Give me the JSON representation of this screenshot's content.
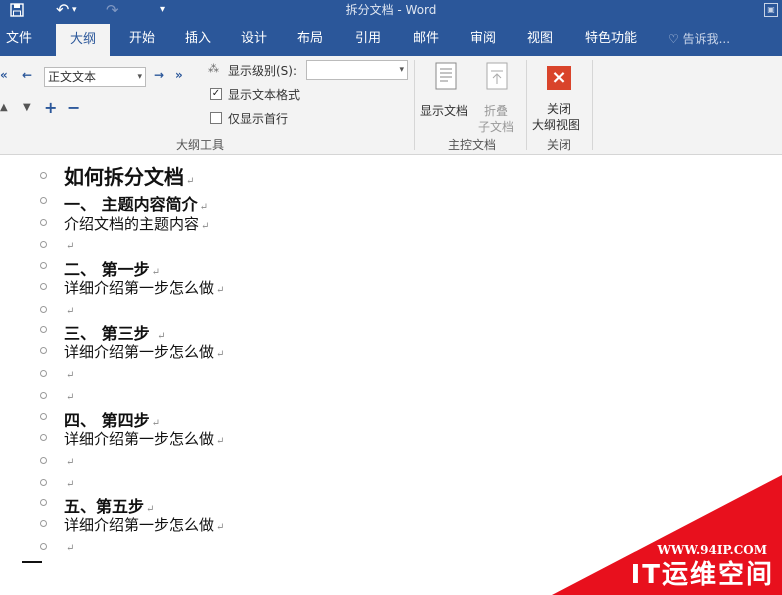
{
  "window": {
    "title": "拆分文档 - Word",
    "undo_glyph": "↶",
    "redo_glyph": "↷",
    "more_glyph": "▾"
  },
  "tabs": [
    {
      "label": "文件"
    },
    {
      "label": "大纲",
      "active": true
    },
    {
      "label": "开始"
    },
    {
      "label": "插入"
    },
    {
      "label": "设计"
    },
    {
      "label": "布局"
    },
    {
      "label": "引用"
    },
    {
      "label": "邮件"
    },
    {
      "label": "审阅"
    },
    {
      "label": "视图"
    },
    {
      "label": "特色功能"
    },
    {
      "label": "告诉我..."
    }
  ],
  "ribbon": {
    "outline_tools": {
      "group_label": "大纲工具",
      "level_value": "正文文本",
      "show_level_label": "显示级别(S):",
      "show_level_value": "",
      "show_text_format": "显示文本格式",
      "show_text_format_checked": true,
      "show_first_line": "仅显示首行",
      "show_first_line_checked": false
    },
    "master_doc": {
      "group_label": "主控文档",
      "show_doc": "显示文档",
      "collapse": "折叠",
      "subdoc": "子文档"
    },
    "close": {
      "group_label": "关闭",
      "label1": "关闭",
      "label2": "大纲视图"
    }
  },
  "document": {
    "lines": [
      {
        "text": "如何拆分文档",
        "mark": "↵"
      },
      {
        "text": "一、  主题内容简介",
        "mark": "↵"
      },
      {
        "text": "介绍文档的主题内容",
        "mark": "↵"
      },
      {
        "text": "",
        "mark": "↵"
      },
      {
        "text": "二、  第一步",
        "mark": "↵"
      },
      {
        "text": "详细介绍第一步怎么做",
        "mark": "↵"
      },
      {
        "text": "",
        "mark": "↵"
      },
      {
        "text": "三、  第三步 ",
        "mark": "↵"
      },
      {
        "text": "详细介绍第一步怎么做",
        "mark": "↵"
      },
      {
        "text": "",
        "mark": "↵"
      },
      {
        "text": "",
        "mark": "↵"
      },
      {
        "text": "四、  第四步",
        "mark": "↵"
      },
      {
        "text": "详细介绍第一步怎么做",
        "mark": "↵"
      },
      {
        "text": "",
        "mark": "↵"
      },
      {
        "text": "",
        "mark": "↵"
      },
      {
        "text": "五、第五步",
        "mark": "↵"
      },
      {
        "text": "详细介绍第一步怎么做",
        "mark": "↵"
      },
      {
        "text": "",
        "mark": "↵"
      }
    ]
  },
  "watermark": {
    "url": "WWW.94IP.COM",
    "name": "IT运维空间"
  }
}
